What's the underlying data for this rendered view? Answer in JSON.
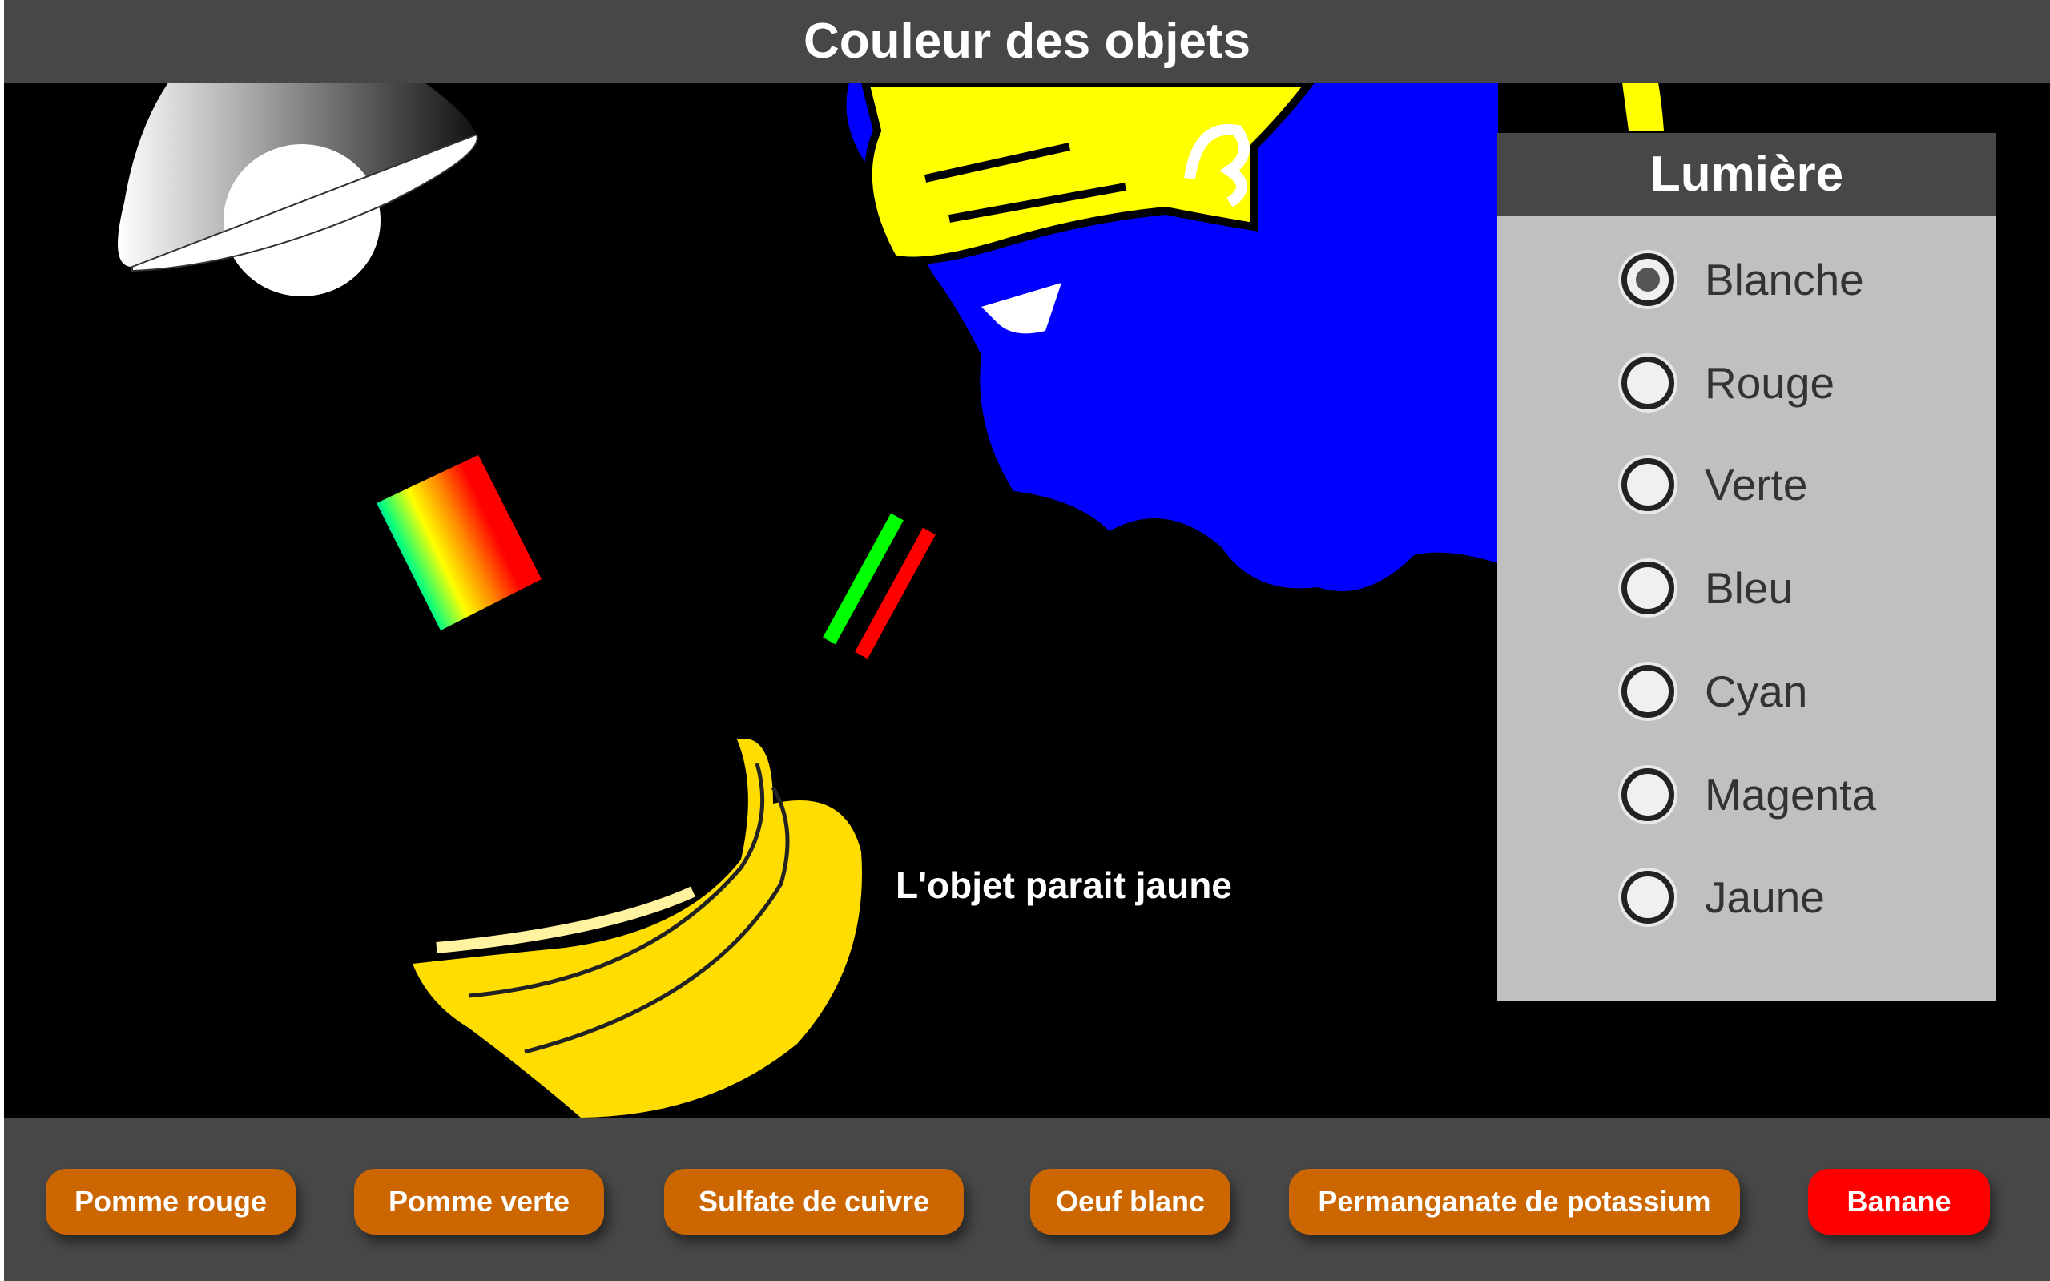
{
  "header": {
    "title": "Couleur des objets"
  },
  "scene": {
    "result_text": "L'objet parait jaune",
    "object_color": "#ffdd00",
    "light_color": "#ffffff"
  },
  "panel": {
    "title": "Lumière",
    "selected": "Blanche",
    "options": [
      "Blanche",
      "Rouge",
      "Verte",
      "Bleu",
      "Cyan",
      "Magenta",
      "Jaune"
    ]
  },
  "objects": {
    "selected": "Banane",
    "buttons": [
      "Pomme rouge",
      "Pomme verte",
      "Sulfate de cuivre",
      "Oeuf blanc",
      "Permanganate de potassium",
      "Banane"
    ]
  },
  "colors": {
    "bar": "#474747",
    "button": "#cc6600",
    "button_active": "#ff0000",
    "panel": "#c0c0c0"
  }
}
